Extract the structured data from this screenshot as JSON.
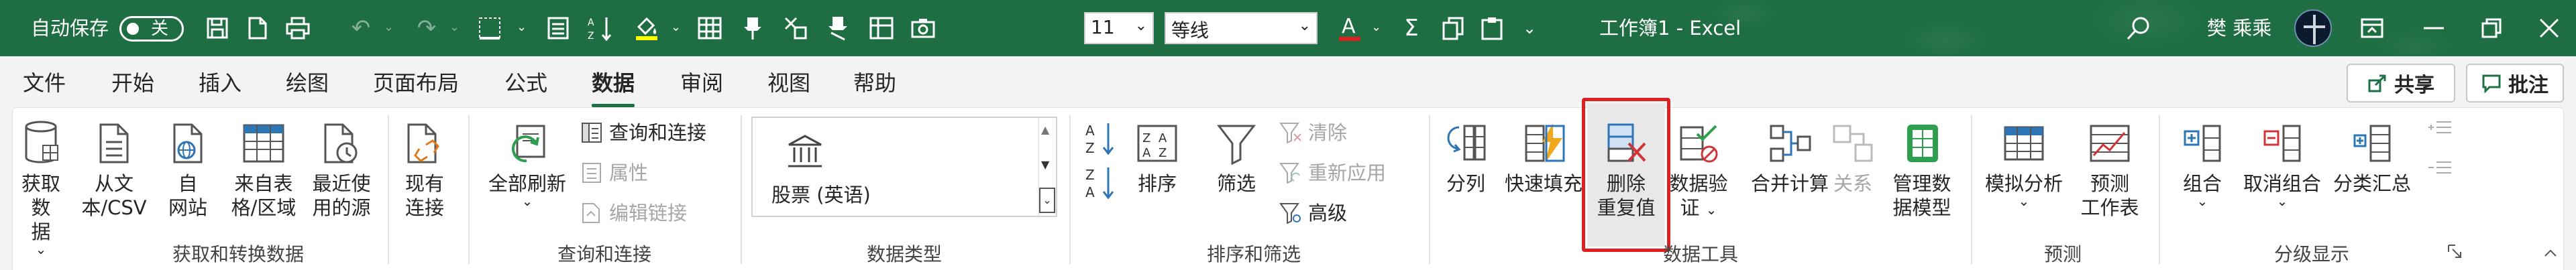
{
  "titlebar": {
    "autosave_label": "自动保存",
    "autosave_state": "关",
    "font_size": "11",
    "font_name": "等线",
    "document_title": "工作簿1 - Excel",
    "user_name": "樊 乘乘"
  },
  "tabs": [
    "文件",
    "开始",
    "插入",
    "绘图",
    "页面布局",
    "公式",
    "数据",
    "审阅",
    "视图",
    "帮助"
  ],
  "active_tab": "数据",
  "share_label": "共享",
  "comments_label": "批注",
  "groups": {
    "get_transform": {
      "label": "获取和转换数据",
      "get_data": [
        "获取数",
        "据"
      ],
      "from_csv": [
        "从文",
        "本/CSV"
      ],
      "from_web": [
        "自",
        "网站"
      ],
      "from_table": [
        "来自表",
        "格/区域"
      ],
      "recent_sources": [
        "最近使",
        "用的源"
      ],
      "existing_conn": [
        "现有",
        "连接"
      ]
    },
    "queries": {
      "label": "查询和连接",
      "refresh_all": "全部刷新",
      "queries_connections": "查询和连接",
      "properties": "属性",
      "edit_links": "编辑链接"
    },
    "data_types": {
      "label": "数据类型",
      "stocks": "股票 (英语)"
    },
    "sort_filter": {
      "label": "排序和筛选",
      "sort": "排序",
      "filter": "筛选",
      "clear": "清除",
      "reapply": "重新应用",
      "advanced": "高级"
    },
    "data_tools": {
      "label": "数据工具",
      "text_to_columns": "分列",
      "flash_fill": "快速填充",
      "remove_duplicates": [
        "删除",
        "重复值"
      ],
      "data_validation": [
        "数据验",
        "证"
      ],
      "consolidate": "合并计算",
      "relationships": "关系",
      "data_model": [
        "管理数",
        "据模型"
      ]
    },
    "forecast": {
      "label": "预测",
      "what_if": "模拟分析",
      "forecast_sheet": [
        "预测",
        "工作表"
      ]
    },
    "outline": {
      "label": "分级显示",
      "group": "组合",
      "ungroup": "取消组合",
      "subtotal": "分类汇总"
    }
  },
  "colors": {
    "title_bar": "#1f6e43",
    "accent": "#1e7145",
    "highlight_box": "#e02020"
  }
}
